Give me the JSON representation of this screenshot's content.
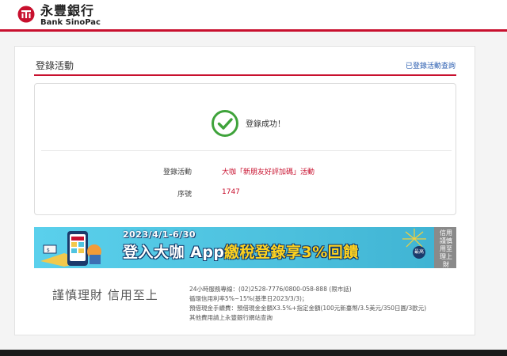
{
  "header": {
    "bank_name_cn": "永豐銀行",
    "bank_name_en": "Bank SinoPac",
    "brand_color": "#c8102e",
    "logo_icon": "sinopac-logo-icon"
  },
  "section": {
    "title": "登錄活動",
    "query_link": "已登錄活動查詢"
  },
  "result": {
    "icon": "check-circle-icon",
    "icon_color": "#3fa33b",
    "message": "登錄成功！",
    "rows": [
      {
        "label": "登錄活動",
        "value": "大咖「新朋友好評加碼」活動"
      },
      {
        "label": "序號",
        "value": "1747"
      }
    ]
  },
  "banner": {
    "date_range": "2023/4/1-6/30",
    "headline_part1": "登入大咖 App",
    "headline_part2": "繳稅登錄享3%回饋",
    "badge": "最高",
    "side_tag": "信用 謹慎 用至 理上 財"
  },
  "footer": {
    "slogan": "謹慎理財 信用至上",
    "lines": [
      "24小時服務專線：(02)2528-7776/0800-058-888 (限市話)",
      "循環信用利率5%~15%(基準日2023/3/3)；",
      "預借現金手續費：預借現金金額X3.5%+指定金額(100元新臺幣/3.5美元/350日圓/3歐元)",
      "其他費用請上永豐銀行網站查詢"
    ]
  }
}
